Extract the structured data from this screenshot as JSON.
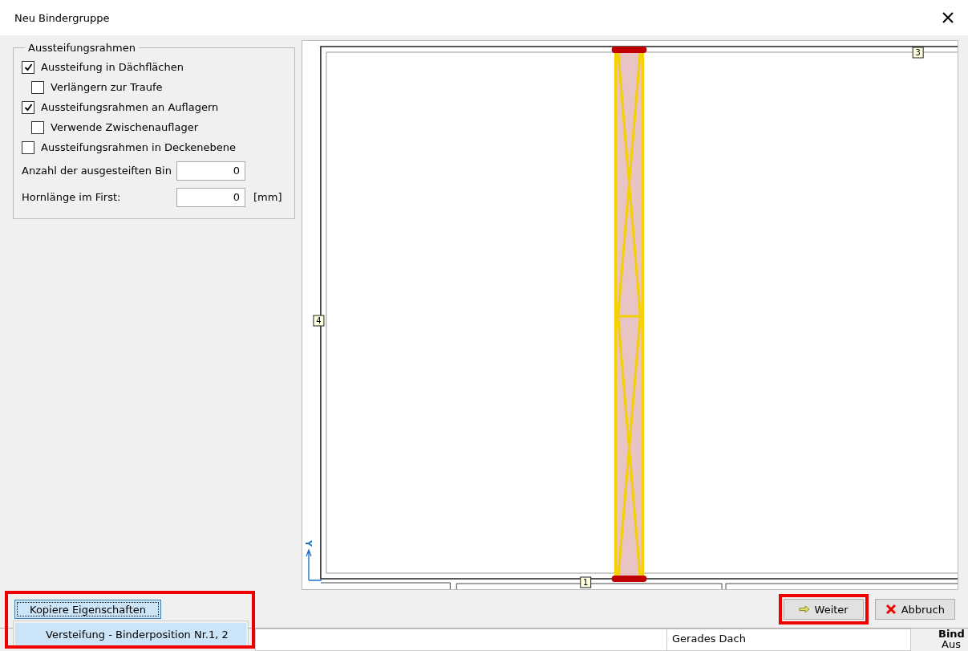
{
  "window": {
    "title": "Neu Bindergruppe"
  },
  "group": {
    "title": "Aussteifungsrahmen",
    "options": [
      {
        "label": "Aussteifung in Dächflächen",
        "checked": true,
        "children": [
          {
            "label": "Verlängern zur Traufe",
            "checked": false
          }
        ]
      },
      {
        "label": "Aussteifungsrahmen an Auflagern",
        "checked": true,
        "children": [
          {
            "label": "Verwende Zwischenauflager",
            "checked": false
          }
        ]
      },
      {
        "label": "Aussteifungsrahmen in Deckenebene",
        "checked": false
      }
    ],
    "fields": [
      {
        "label": "Anzahl der ausgesteiften Bin",
        "value": "0"
      },
      {
        "label": "Hornlänge im First:",
        "value": "0",
        "unit": "[mm]"
      }
    ]
  },
  "canvas": {
    "markers": [
      {
        "text": "3"
      },
      {
        "text": "4"
      },
      {
        "text": "1"
      }
    ],
    "axis_label": "Y"
  },
  "copy_button": {
    "label": "Kopiere Eigenschaften",
    "menu": [
      {
        "label": "Versteifung - Binderposition Nr.1, 2",
        "selected": true
      }
    ]
  },
  "buttons": [
    {
      "kind": "next",
      "label": "Weiter"
    },
    {
      "kind": "cancel",
      "label": "Abbruch"
    }
  ],
  "background": {
    "cell": "Gerades Dach",
    "panel_title": "Bind",
    "panel_text": "Aus"
  }
}
